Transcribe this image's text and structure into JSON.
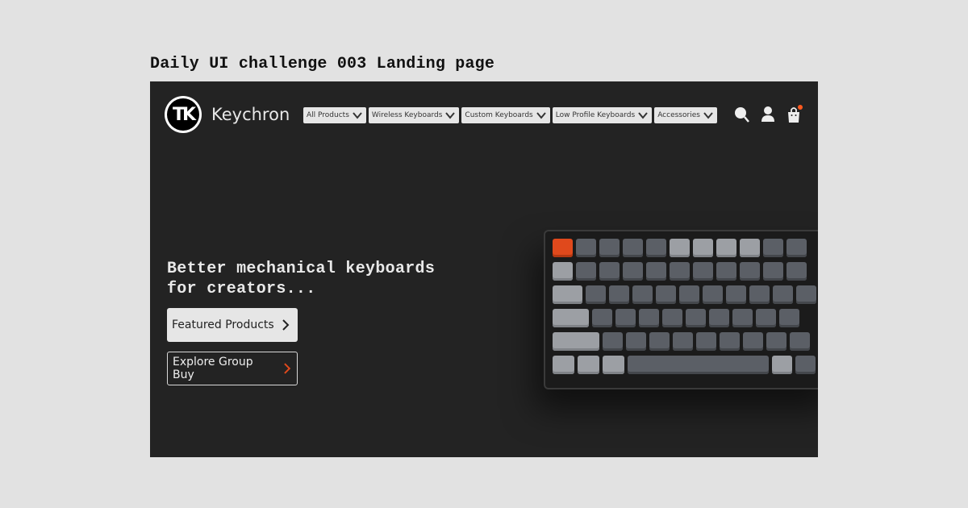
{
  "shot_title": "Daily UI challenge 003 Landing page",
  "header": {
    "brand_name": "Keychron",
    "logo_glyph": "TK",
    "nav": [
      {
        "label": "All Products"
      },
      {
        "label": "Wireless Keyboards"
      },
      {
        "label": "Custom Keyboards"
      },
      {
        "label": "Low Profile Keyboards"
      },
      {
        "label": "Accessories"
      }
    ],
    "icons": [
      "search-icon",
      "user-icon",
      "cart-icon"
    ]
  },
  "hero": {
    "headline_line1": "Better mechanical keyboards",
    "headline_line2": "for creators...",
    "primary_button": "Featured Products",
    "secondary_button": "Explore Group Buy"
  },
  "colors": {
    "background": "#232323",
    "accent": "#e0491c",
    "nav_bg": "#e6e6e6",
    "page_bg": "#e2e2e2"
  }
}
